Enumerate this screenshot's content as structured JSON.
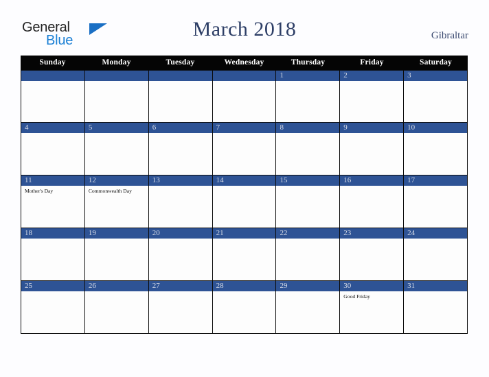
{
  "brand": {
    "line1": "General",
    "line2": "Blue",
    "triangle_color": "#1a6fc4"
  },
  "header": {
    "title": "March 2018",
    "country": "Gibraltar",
    "title_color": "#2d3e66"
  },
  "calendar": {
    "weekdays": [
      "Sunday",
      "Monday",
      "Tuesday",
      "Wednesday",
      "Thursday",
      "Friday",
      "Saturday"
    ],
    "header_bg": "#050505",
    "date_bar_color": "#2e5395",
    "weeks": [
      [
        {
          "date": "",
          "events": []
        },
        {
          "date": "",
          "events": []
        },
        {
          "date": "",
          "events": []
        },
        {
          "date": "",
          "events": []
        },
        {
          "date": "1",
          "events": []
        },
        {
          "date": "2",
          "events": []
        },
        {
          "date": "3",
          "events": []
        }
      ],
      [
        {
          "date": "4",
          "events": []
        },
        {
          "date": "5",
          "events": []
        },
        {
          "date": "6",
          "events": []
        },
        {
          "date": "7",
          "events": []
        },
        {
          "date": "8",
          "events": []
        },
        {
          "date": "9",
          "events": []
        },
        {
          "date": "10",
          "events": []
        }
      ],
      [
        {
          "date": "11",
          "events": [
            "Mother's Day"
          ]
        },
        {
          "date": "12",
          "events": [
            "Commonwealth Day"
          ]
        },
        {
          "date": "13",
          "events": []
        },
        {
          "date": "14",
          "events": []
        },
        {
          "date": "15",
          "events": []
        },
        {
          "date": "16",
          "events": []
        },
        {
          "date": "17",
          "events": []
        }
      ],
      [
        {
          "date": "18",
          "events": []
        },
        {
          "date": "19",
          "events": []
        },
        {
          "date": "20",
          "events": []
        },
        {
          "date": "21",
          "events": []
        },
        {
          "date": "22",
          "events": []
        },
        {
          "date": "23",
          "events": []
        },
        {
          "date": "24",
          "events": []
        }
      ],
      [
        {
          "date": "25",
          "events": []
        },
        {
          "date": "26",
          "events": []
        },
        {
          "date": "27",
          "events": []
        },
        {
          "date": "28",
          "events": []
        },
        {
          "date": "29",
          "events": []
        },
        {
          "date": "30",
          "events": [
            "Good Friday"
          ]
        },
        {
          "date": "31",
          "events": []
        }
      ]
    ]
  }
}
